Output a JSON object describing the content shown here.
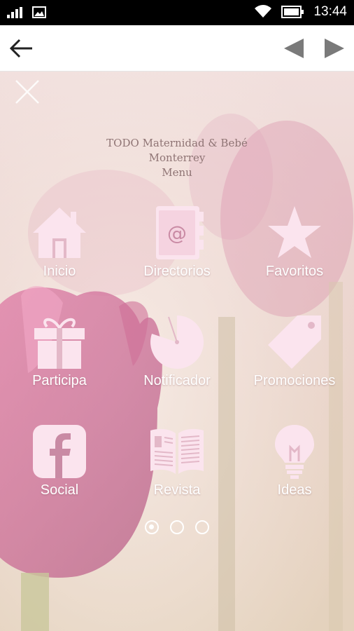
{
  "status_bar": {
    "time": "13:44",
    "icons": [
      "signal-icon",
      "image-notification-icon",
      "wifi-icon",
      "battery-icon"
    ]
  },
  "nav": {
    "back_icon": "arrow-left-icon",
    "prev_icon": "triangle-left-icon",
    "next_icon": "triangle-right-icon"
  },
  "menu": {
    "close_icon": "close-icon",
    "title_lines": "TODO  Maternidad & Bebé\nMonterrey\nMenu",
    "items": [
      {
        "label": "Inicio",
        "icon": "home-icon"
      },
      {
        "label": "Directorios",
        "icon": "address-book-icon"
      },
      {
        "label": "Favoritos",
        "icon": "star-icon"
      },
      {
        "label": "Participa",
        "icon": "gift-icon"
      },
      {
        "label": "Notificador",
        "icon": "notifier-pie-icon"
      },
      {
        "label": "Promociones",
        "icon": "tag-icon"
      },
      {
        "label": "Social",
        "icon": "facebook-icon"
      },
      {
        "label": "Revista",
        "icon": "magazine-icon"
      },
      {
        "label": "Ideas",
        "icon": "lightbulb-icon"
      }
    ],
    "pages": {
      "count": 3,
      "active": 1
    }
  },
  "colors": {
    "icon_fill": "#fbe4ee",
    "label": "#ffffff",
    "title": "#8f7474",
    "status_bg": "#000000",
    "nav_bg": "#ffffff",
    "nav_icon": "#7a7a7a"
  }
}
